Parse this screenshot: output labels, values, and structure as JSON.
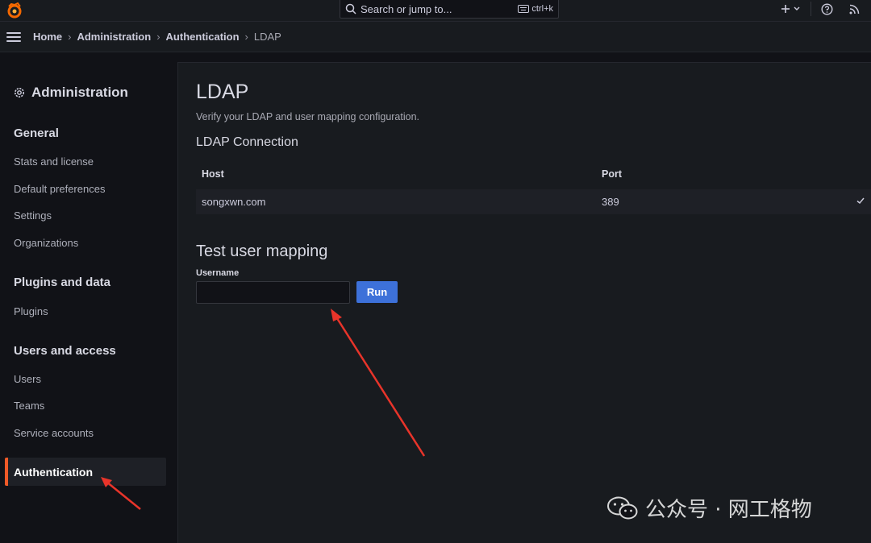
{
  "topbar": {
    "logo_icon": "grafana-logo-icon",
    "search_placeholder": "Search or jump to...",
    "shortcut": "ctrl+k",
    "add_icon": "plus-icon",
    "help_icon": "help-circle-icon",
    "news_icon": "rss-icon"
  },
  "breadcrumb": {
    "items": [
      "Home",
      "Administration",
      "Authentication",
      "LDAP"
    ]
  },
  "sidebar": {
    "title": "Administration",
    "sections": [
      {
        "label": "General",
        "items": [
          "Stats and license",
          "Default preferences",
          "Settings",
          "Organizations"
        ]
      },
      {
        "label": "Plugins and data",
        "items": [
          "Plugins"
        ]
      },
      {
        "label": "Users and access",
        "items": [
          "Users",
          "Teams",
          "Service accounts"
        ]
      }
    ],
    "active_item": "Authentication"
  },
  "main": {
    "title": "LDAP",
    "subtitle": "Verify your LDAP and user mapping configuration.",
    "connection": {
      "heading": "LDAP Connection",
      "columns": [
        "Host",
        "Port"
      ],
      "rows": [
        {
          "host": "songxwn.com",
          "port": "389",
          "status_icon": "check-icon"
        }
      ]
    },
    "test": {
      "heading": "Test user mapping",
      "username_label": "Username",
      "username_value": "",
      "run_label": "Run"
    }
  },
  "watermark": {
    "text": "公众号 · 网工格物",
    "icon": "wechat-icon"
  },
  "colors": {
    "accent": "#3d71d9",
    "active_bar": "#f05a28",
    "arrow": "#e8342a"
  }
}
